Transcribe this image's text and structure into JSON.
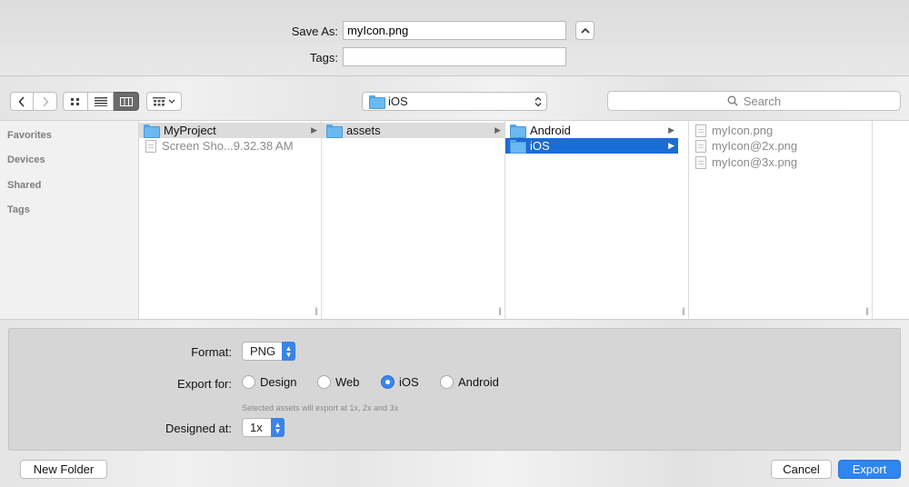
{
  "save_as": {
    "label": "Save As:",
    "value": "myIcon.png"
  },
  "tags": {
    "label": "Tags:",
    "value": ""
  },
  "toolbar": {
    "location": "iOS",
    "search_placeholder": "Search"
  },
  "sidebar": {
    "sections": [
      "Favorites",
      "Devices",
      "Shared",
      "Tags"
    ]
  },
  "columns": [
    {
      "items": [
        {
          "name": "MyProject",
          "kind": "folder",
          "state": "highlight"
        },
        {
          "name": "Screen Sho...9.32.38 AM",
          "kind": "file",
          "state": "dim"
        }
      ]
    },
    {
      "items": [
        {
          "name": "assets",
          "kind": "folder",
          "state": "highlight"
        }
      ]
    },
    {
      "items": [
        {
          "name": "Android",
          "kind": "folder",
          "state": ""
        },
        {
          "name": "iOS",
          "kind": "folder",
          "state": "selected"
        }
      ]
    },
    {
      "items": [
        {
          "name": "myIcon.png",
          "kind": "file",
          "state": "dim"
        },
        {
          "name": "myIcon@2x.png",
          "kind": "file",
          "state": "dim"
        },
        {
          "name": "myIcon@3x.png",
          "kind": "file",
          "state": "dim"
        }
      ]
    }
  ],
  "options": {
    "format_label": "Format:",
    "format_value": "PNG",
    "export_for_label": "Export for:",
    "export_for_options": [
      "Design",
      "Web",
      "iOS",
      "Android"
    ],
    "export_for_selected": "iOS",
    "hint": "Selected assets will export at 1x, 2x and 3x",
    "designed_at_label": "Designed at:",
    "designed_at_value": "1x"
  },
  "buttons": {
    "new_folder": "New Folder",
    "cancel": "Cancel",
    "export": "Export"
  },
  "colors": {
    "accent": "#2f86f0",
    "selection": "#1a6dd6"
  }
}
